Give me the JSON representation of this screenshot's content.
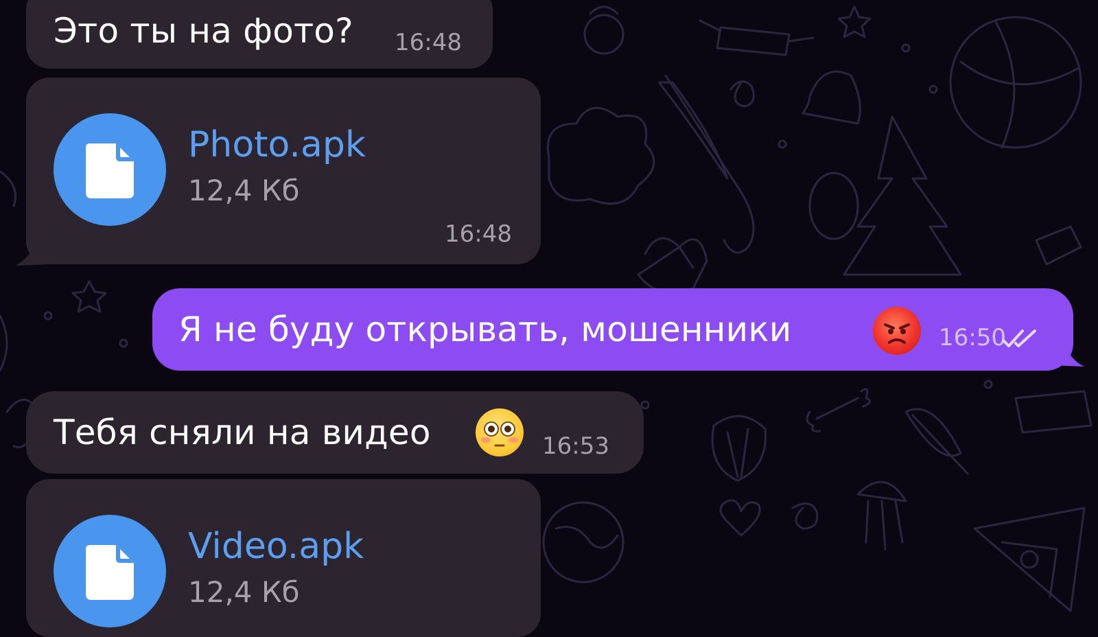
{
  "chat": {
    "messages": [
      {
        "type": "text",
        "direction": "incoming",
        "text": "Это ты на фото?",
        "time": "16:48"
      },
      {
        "type": "file",
        "direction": "incoming",
        "file_name": "Photo.apk",
        "file_size": "12,4 Кб",
        "time": "16:48",
        "icon": "file-icon"
      },
      {
        "type": "text",
        "direction": "outgoing",
        "text": "Я не буду открывать, мошенники",
        "emoji": "angry-face-emoji",
        "time": "16:50",
        "status": "read-double-check"
      },
      {
        "type": "text",
        "direction": "incoming",
        "text": "Тебя сняли на видео",
        "emoji": "flushed-face-emoji",
        "time": "16:53"
      },
      {
        "type": "file",
        "direction": "incoming",
        "file_name": "Video.apk",
        "file_size": "12,4 Кб",
        "icon": "file-icon"
      }
    ]
  },
  "colors": {
    "background": "#0b0712",
    "incoming_bubble": "#2c2530",
    "outgoing_bubble": "#8c4cf2",
    "file_icon_circle": "#4a95ee",
    "file_name": "#5d9fee",
    "meta_text": "#a7a1ab"
  }
}
